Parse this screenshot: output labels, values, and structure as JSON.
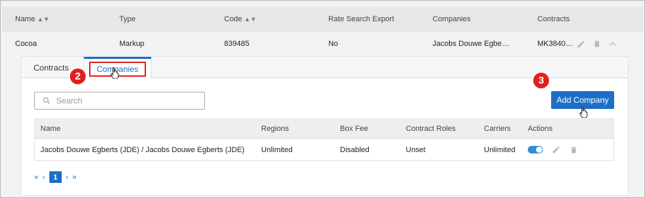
{
  "outer_table": {
    "headers": {
      "name": "Name",
      "type": "Type",
      "code": "Code",
      "rate_search_export": "Rate Search Export",
      "companies": "Companies",
      "contracts": "Contracts"
    },
    "row": {
      "name": "Cocoa",
      "type": "Markup",
      "code": "839485",
      "rate_search_export": "No",
      "companies": "Jacobs Douwe Egbe…",
      "contracts": "MK3840…"
    }
  },
  "tabs": {
    "contracts": "Contracts",
    "companies": "Companies",
    "active": "Companies"
  },
  "search": {
    "placeholder": "Search"
  },
  "add_company_button": "Add Company",
  "inner_table": {
    "headers": {
      "name": "Name",
      "regions": "Regions",
      "box_fee": "Box Fee",
      "contract_roles": "Contract Roles",
      "carriers": "Carriers",
      "actions": "Actions"
    },
    "rows": [
      {
        "name": "Jacobs Douwe Egberts (JDE) / Jacobs Douwe Egberts (JDE)",
        "regions": "Unlimited",
        "box_fee": "Disabled",
        "contract_roles": "Unset",
        "carriers": "Unlimited",
        "enabled": true
      }
    ]
  },
  "pagination": {
    "first": "«",
    "prev": "‹",
    "current": "1",
    "next": "›",
    "last": "»"
  },
  "annotations": {
    "step_2": "2",
    "step_3": "3"
  },
  "colors": {
    "accent": "#1c6fc6",
    "highlight": "#e02020",
    "toggle_on": "#2b90d9"
  },
  "icons": [
    "sort-icon",
    "edit-icon",
    "trash-icon",
    "chevron-up-icon",
    "search-icon",
    "hand-cursor-icon"
  ]
}
